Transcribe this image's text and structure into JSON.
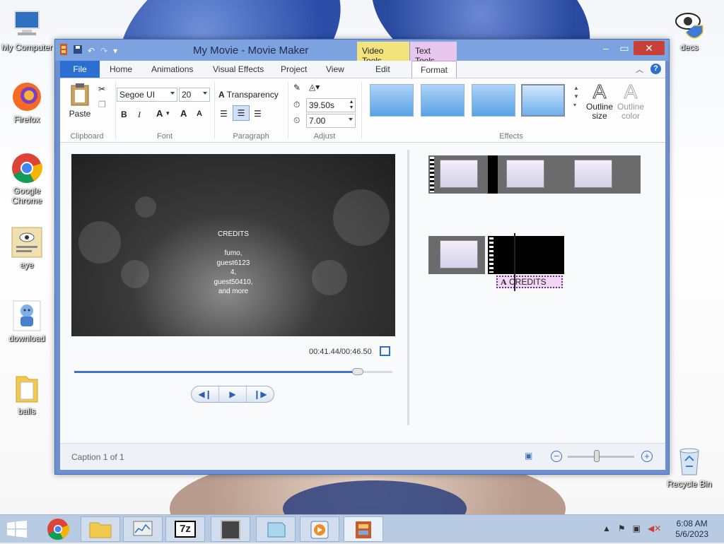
{
  "desktop": {
    "icons": [
      {
        "label": "My Computer"
      },
      {
        "label": "Firefox"
      },
      {
        "label": "Google Chrome"
      },
      {
        "label": "eye"
      },
      {
        "label": "download"
      },
      {
        "label": "balls"
      },
      {
        "label": "decs"
      },
      {
        "label": "Recycle Bin"
      }
    ]
  },
  "window": {
    "title": "My Movie - Movie Maker",
    "contextual_tabs": {
      "video_tools": "Video Tools",
      "text_tools": "Text Tools"
    },
    "tabs": [
      "File",
      "Home",
      "Animations",
      "Visual Effects",
      "Project",
      "View",
      "Edit",
      "Format"
    ],
    "active_tab": "Format"
  },
  "ribbon": {
    "clipboard": {
      "paste": "Paste",
      "label": "Clipboard"
    },
    "font": {
      "family": "Segoe UI",
      "size": "20",
      "label": "Font",
      "bold": "B",
      "italic": "I",
      "color": "A",
      "grow": "A",
      "shrink": "A"
    },
    "paragraph": {
      "transparency": "Transparency",
      "label": "Paragraph"
    },
    "adjust": {
      "start_time": "39.50s",
      "duration": "7.00",
      "label": "Adjust"
    },
    "effects": {
      "label": "Effects",
      "outline_size": "Outline size",
      "outline_color": "Outline color"
    }
  },
  "preview": {
    "lines": [
      "CREDITS",
      "",
      "fumo,",
      "guest6123",
      "4,",
      "guest50410,",
      "and more"
    ],
    "timecode": "00:41.44/00:46.50",
    "progress": 0.89
  },
  "storyboard": {
    "caption_label": "CREDITS"
  },
  "status": {
    "caption": "Caption 1 of 1",
    "zoom_minus": "−",
    "zoom_plus": "+"
  },
  "taskbar": {
    "time": "6:08 AM",
    "date": "5/6/2023"
  },
  "colors": {
    "accent": "#2b6fd1",
    "close": "#c7403a",
    "video_tools": "#f3e37d",
    "text_tools": "#e8c7ee"
  }
}
